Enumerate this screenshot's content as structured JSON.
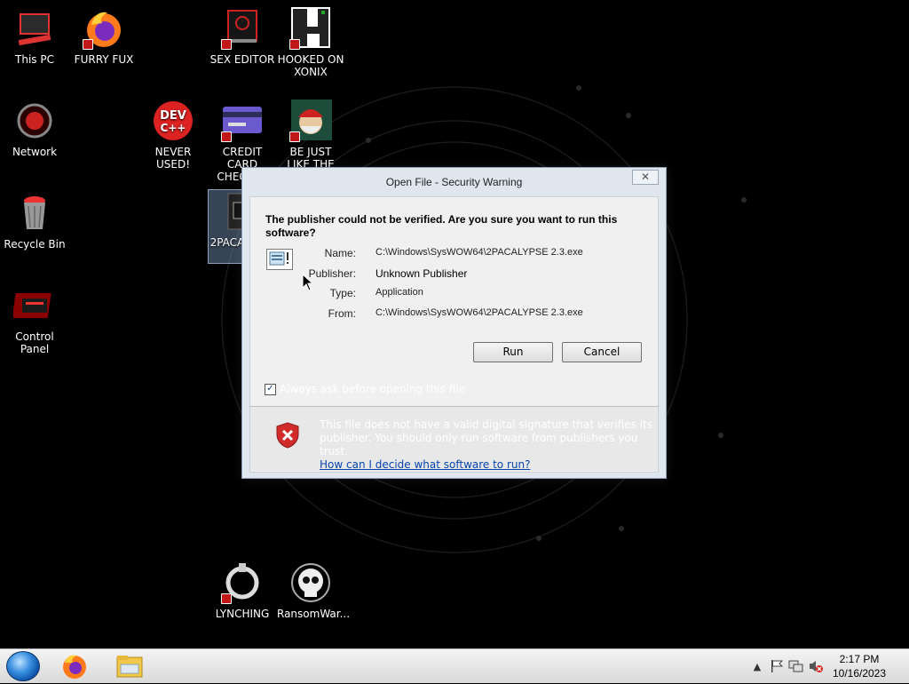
{
  "desktop": {
    "icons": [
      {
        "label": "This PC"
      },
      {
        "label": "FURRY FUX"
      },
      {
        "label": "SEX EDITOR"
      },
      {
        "label": "HOOKED ON XONIX"
      },
      {
        "label": "Network"
      },
      {
        "label": "NEVER USED!"
      },
      {
        "label": "CREDIT CARD CHECKER"
      },
      {
        "label": "BE JUST LIKE THE DUDE!"
      },
      {
        "label": "Recycle Bin"
      },
      {
        "label": "2PACA... 2..."
      },
      {
        "label": "Control Panel"
      },
      {
        "label": "LYNCHING"
      },
      {
        "label": "RansomWar..."
      }
    ]
  },
  "dialog": {
    "title": "Open File - Security Warning",
    "close_glyph": "✕",
    "question": "The publisher could not be verified.  Are you sure you want to run this software?",
    "fields": [
      {
        "label": "Name:",
        "value": "C:\\Windows\\SysWOW64\\2PACALYPSE 2.3.exe"
      },
      {
        "label": "Publisher:",
        "value": "Unknown Publisher"
      },
      {
        "label": "Type:",
        "value": "Application"
      },
      {
        "label": "From:",
        "value": "C:\\Windows\\SysWOW64\\2PACALYPSE 2.3.exe"
      }
    ],
    "run_label": "Run",
    "cancel_label": "Cancel",
    "checkbox_label": "Always ask before opening this file",
    "checkbox_checked": true,
    "warning_text": "This file does not have a valid digital signature that verifies its publisher.  You should only run software from publishers you trust.",
    "warning_link": "How can I decide what software to run?"
  },
  "taskbar": {
    "time": "2:17 PM",
    "date": "10/16/2023"
  },
  "colors": {
    "link": "#0645ad",
    "shield": "#d12b2b",
    "desktop_bg": "#000000"
  }
}
